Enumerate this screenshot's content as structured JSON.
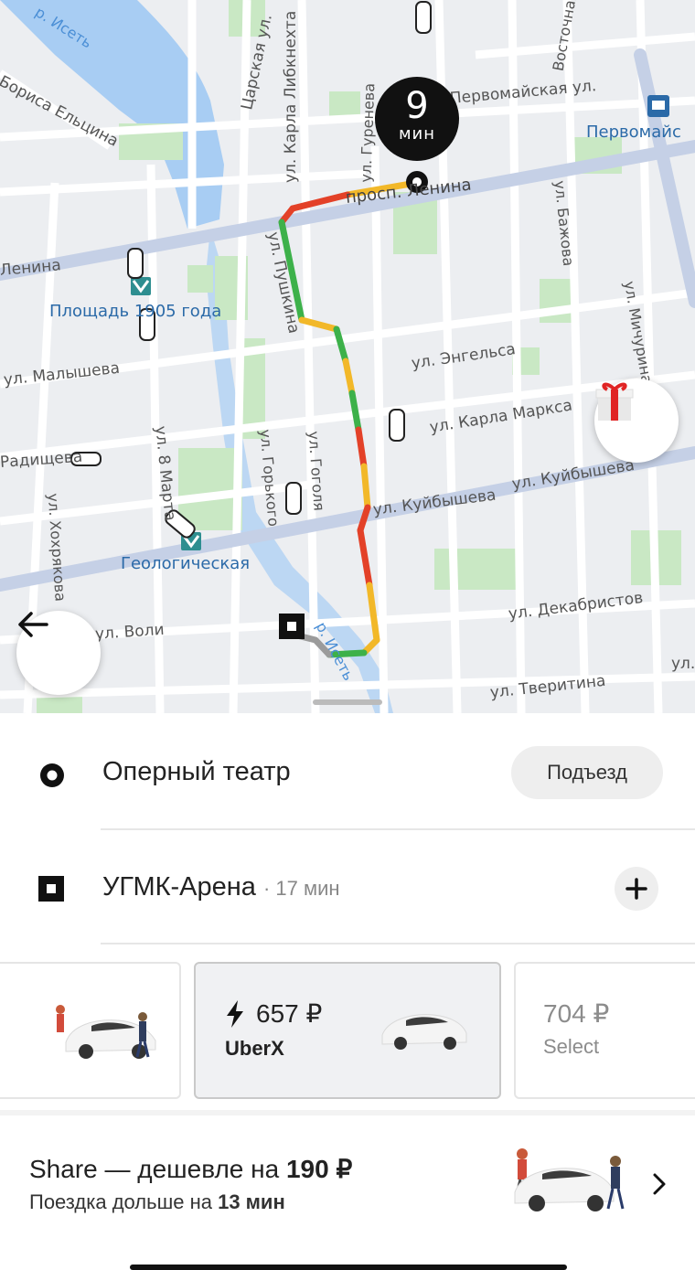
{
  "map": {
    "street_labels": {
      "karla_libknekhta": "ул. Карла Либкнехта",
      "tsarskaya": "Царская ул.",
      "gurzufskaya": "ул. Гуренева",
      "pervomaiskaya": "Первомайская ул.",
      "vostochnaya": "Восточная ул.",
      "borisa_eltsina": "Бориса Ельцина",
      "prosp_lenina": "просп. Ленина",
      "lenina_left": "Ленина",
      "bazhova": "ул. Бажова",
      "pushkina": "ул. Пушкина",
      "michurina": "ул. Мичурина",
      "malysheva": "ул. Малышева",
      "engelsa": "ул. Энгельса",
      "karla_marksa": "ул. Карла Маркса",
      "radishcheva": "Радищева",
      "gorkogo": "ул. Горького",
      "gogolya": "ул. Гоголя",
      "vosmogo_marta": "ул. 8 Марта",
      "hohryakova": "ул. Хохрякова",
      "kuibysheva_1": "ул. Куйбышева",
      "kuibysheva_2": "ул. Куйбышева",
      "dekabristov": "ул. Декабристов",
      "voli": "ул. Воли",
      "tveritina": "ул. Тверитина",
      "ul_right": "ул."
    },
    "place_labels": {
      "ploshchad": "Площадь 1905 года",
      "geologicheskaya": "Геологическая",
      "pervomaiskaya_metro": "Первомайс"
    },
    "river_labels": {
      "top": "р. Исеть",
      "bottom": "р. Исеть"
    },
    "eta": {
      "value": "9",
      "unit": "мин"
    },
    "icons": {
      "back": "arrow-left-icon",
      "gift": "gift-icon"
    }
  },
  "trip": {
    "pickup": {
      "name": "Оперный театр",
      "entrance_button": "Подъезд"
    },
    "destination": {
      "name": "УГМК-Арена",
      "duration": "· 17 мин"
    }
  },
  "tariffs": [
    {
      "price": "",
      "name": "",
      "selected": false
    },
    {
      "price": "657 ₽",
      "name": "UberX",
      "selected": true,
      "surge": true
    },
    {
      "price": "704 ₽",
      "name": "Select",
      "selected": false
    }
  ],
  "share": {
    "title_prefix": "Share — дешевле на ",
    "title_amount": "190 ₽",
    "subtitle_prefix": "Поездка дольше на ",
    "subtitle_amount": "13 мин"
  },
  "colors": {
    "route_green": "#3db14a",
    "route_yellow": "#f2b829",
    "route_red": "#e34128",
    "water": "#a8cdf3",
    "park": "#c9e8c4",
    "main_road": "#c5d0e6"
  }
}
